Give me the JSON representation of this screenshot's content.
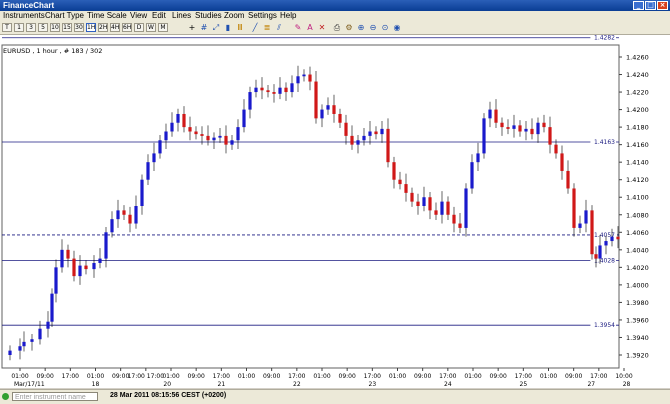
{
  "window": {
    "title": "FinanceChart"
  },
  "menu": [
    "Instruments",
    "Chart Type",
    "Time Scale",
    "View",
    "Edit",
    "Lines",
    "Studies",
    "Zoom",
    "Settings",
    "Help"
  ],
  "toolbar": {
    "timeframes": [
      "T",
      "1",
      "3",
      "5",
      "10",
      "15",
      "30",
      "1H",
      "2H",
      "4H",
      "6H",
      "D",
      "W",
      "M"
    ],
    "active_timeframe": "1H"
  },
  "chart": {
    "label": "EURUSD , 1 hour , # 183 / 302",
    "price_axis": {
      "labels": [
        "1.4260",
        "1.4240",
        "1.4220",
        "1.4200",
        "1.4180",
        "1.4160",
        "1.4140",
        "1.4120",
        "1.4100",
        "1.4080",
        "1.4060",
        "1.4040",
        "1.4020",
        "1.4000",
        "1.3980",
        "1.3960",
        "1.3940",
        "1.3920"
      ]
    },
    "lines": [
      {
        "label": "1.4282",
        "value": 1.4282,
        "style": "solid"
      },
      {
        "label": "1.4163",
        "value": 1.4163,
        "style": "solid"
      },
      {
        "label": "1.4057",
        "value": 1.4057,
        "style": "dashed"
      },
      {
        "label": "1.4028",
        "value": 1.4028,
        "style": "solid"
      },
      {
        "label": "1.3954",
        "value": 1.3954,
        "style": "solid"
      }
    ],
    "time_axis": {
      "labels": [
        "01:00",
        "09:00",
        "17:00",
        "01:00",
        "09:00",
        "17:00 17:00",
        "01:00",
        "09:00",
        "17:00",
        "01:00",
        "09:00",
        "17:00",
        "01:00",
        "09:00",
        "17:00",
        "01:00",
        "09:00",
        "17:00",
        "01:00",
        "09:00",
        "17:00",
        "01:00",
        "09:00",
        "17:00",
        "10:00"
      ],
      "dates": [
        "Mar/17/11",
        "18",
        "20",
        "21",
        "22",
        "23",
        "24",
        "25",
        "27",
        "28"
      ]
    },
    "colors": {
      "up": "#1a1acc",
      "down": "#d01818",
      "line": "#1a1a80",
      "grid": "#c8c8d8"
    }
  },
  "status": {
    "instrument_placeholder": "Enter instrument name",
    "datetime": "28 Mar 2011 08:15:56  CEST (+0200)"
  }
}
